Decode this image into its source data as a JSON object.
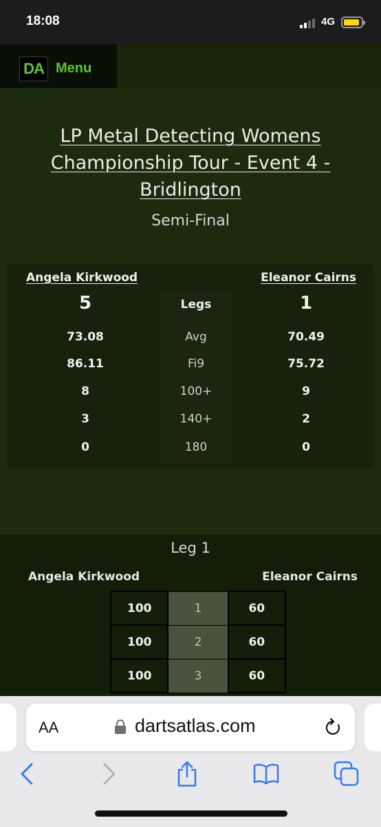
{
  "status": {
    "time": "18:08",
    "network": "4G",
    "battery_color": "#ffd60a"
  },
  "nav": {
    "logo": "DA",
    "menu_label": "Menu",
    "accent_color": "#5cc535"
  },
  "event": {
    "title": "LP Metal Detecting Womens Championship Tour - Event 4 - Bridlington",
    "round": "Semi-Final"
  },
  "match": {
    "player1": "Angela Kirkwood",
    "player2": "Eleanor Cairns",
    "stats": [
      {
        "label": "Legs",
        "p1": "5",
        "p2": "1"
      },
      {
        "label": "Avg",
        "p1": "73.08",
        "p2": "70.49"
      },
      {
        "label": "Fi9",
        "p1": "86.11",
        "p2": "75.72"
      },
      {
        "label": "100+",
        "p1": "8",
        "p2": "9"
      },
      {
        "label": "140+",
        "p1": "3",
        "p2": "2"
      },
      {
        "label": "180",
        "p1": "0",
        "p2": "0"
      }
    ]
  },
  "leg": {
    "title": "Leg 1",
    "player1": "Angela Kirkwood",
    "player2": "Eleanor Cairns",
    "rows": [
      {
        "round": "1",
        "p1": "100",
        "p2": "60"
      },
      {
        "round": "2",
        "p1": "100",
        "p2": "60"
      },
      {
        "round": "3",
        "p1": "100",
        "p2": "60"
      }
    ]
  },
  "browser": {
    "text_size_label": "AA",
    "url": "dartsatlas.com",
    "icons": [
      "lock-icon",
      "reload-icon",
      "back-icon",
      "forward-icon",
      "share-icon",
      "bookmarks-icon",
      "tabs-icon"
    ]
  }
}
